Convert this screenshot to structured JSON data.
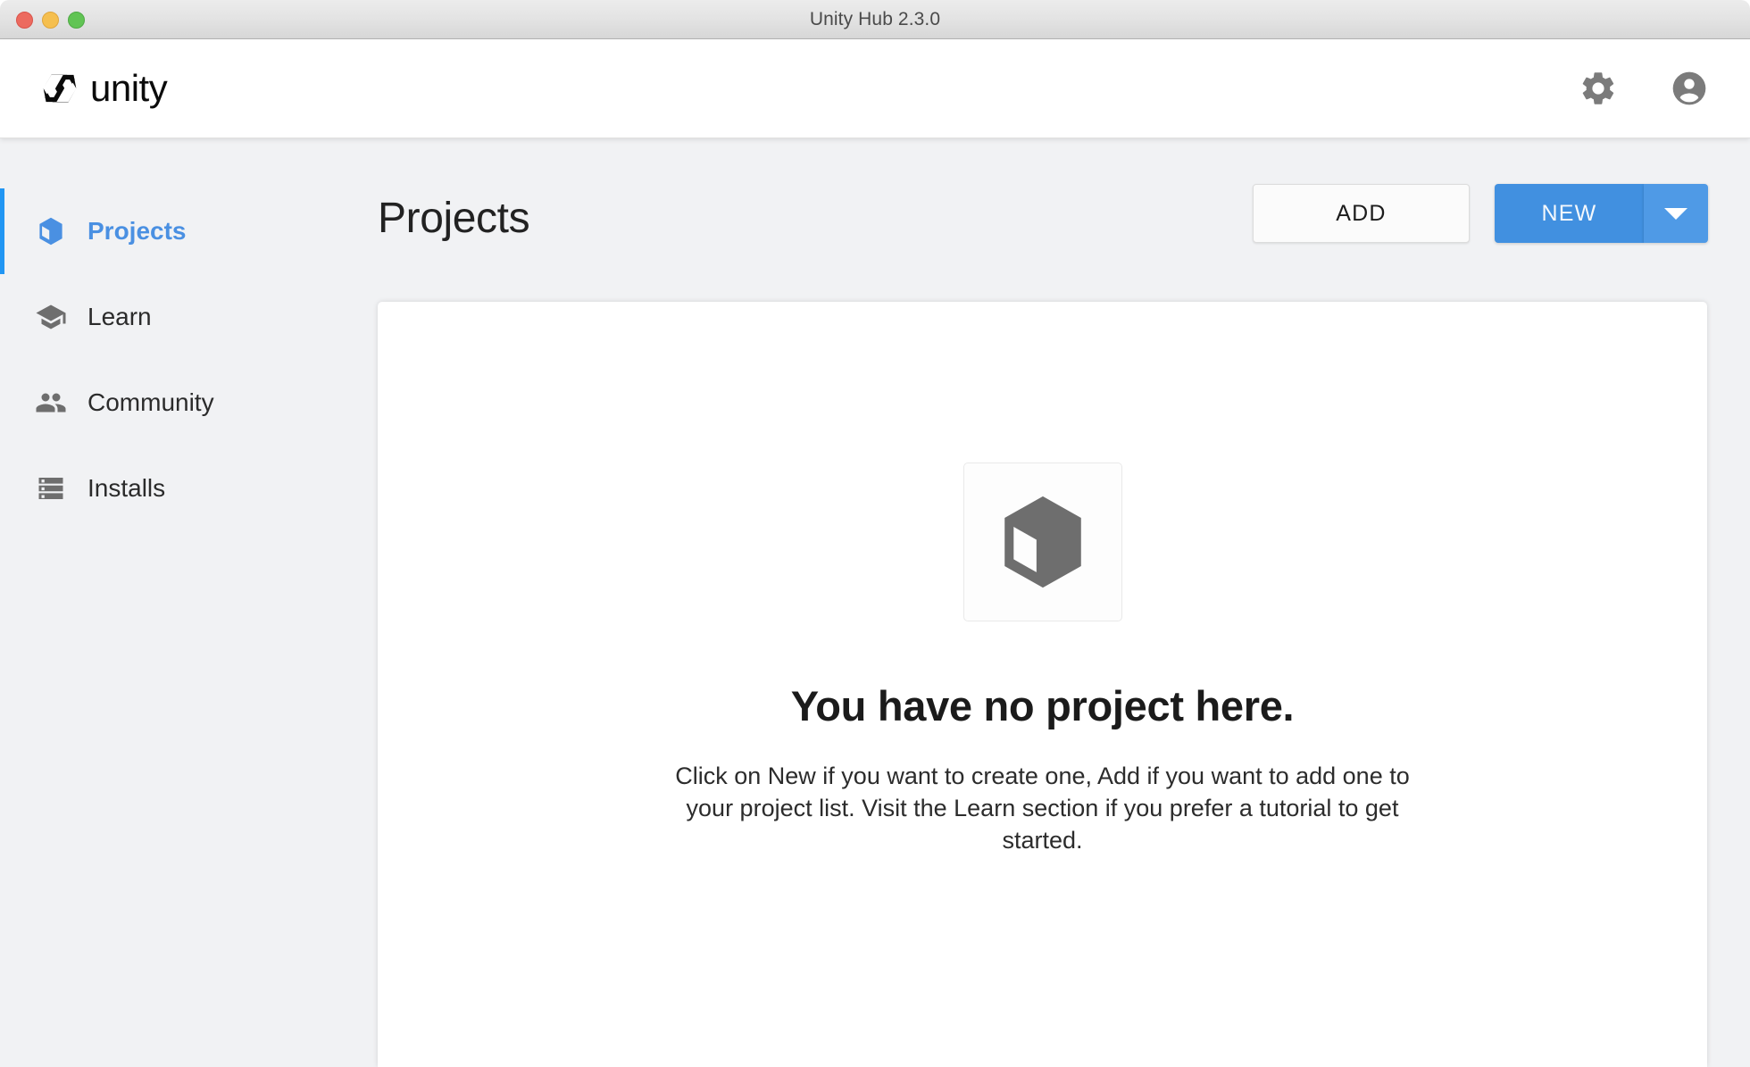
{
  "window": {
    "title": "Unity Hub 2.3.0",
    "controls": [
      {
        "name": "close",
        "color": "#ec6a5f"
      },
      {
        "name": "minimize",
        "color": "#f5bf4f"
      },
      {
        "name": "maximize",
        "color": "#61c454"
      }
    ]
  },
  "header": {
    "logo_text": "unity",
    "logo_icon": "unity-cube-logo",
    "settings_icon": "gear-icon",
    "account_icon": "account-circle-icon"
  },
  "sidebar": {
    "items": [
      {
        "label": "Projects",
        "icon": "cube-icon",
        "active": true
      },
      {
        "label": "Learn",
        "icon": "graduation-cap-icon",
        "active": false
      },
      {
        "label": "Community",
        "icon": "people-icon",
        "active": false
      },
      {
        "label": "Installs",
        "icon": "server-list-icon",
        "active": false
      }
    ]
  },
  "main": {
    "title": "Projects",
    "add_label": "ADD",
    "new_label": "NEW",
    "new_dropdown_icon": "chevron-down-icon"
  },
  "empty_state": {
    "icon": "cube-placeholder-icon",
    "title": "You have no project here.",
    "description": "Click on New if you want to create one, Add if you want to add one to your project list. Visit the Learn section if you prefer a tutorial to get started."
  },
  "colors": {
    "accent_blue": "#4190e0",
    "accent_blue_light": "#4f9ae6",
    "active_nav_blue": "#4a90e2",
    "background_gray": "#f1f2f4",
    "panel_white": "#ffffff",
    "icon_gray": "#6e6e6e"
  }
}
